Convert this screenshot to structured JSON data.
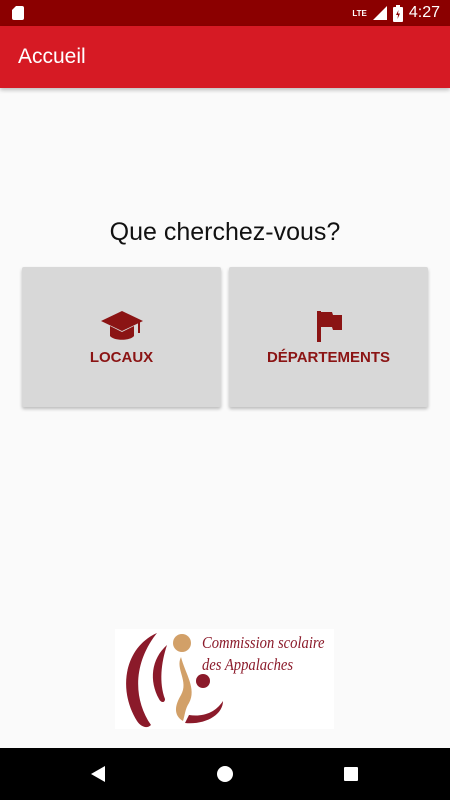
{
  "status_bar": {
    "network": "LTE",
    "time": "4:27"
  },
  "app_bar": {
    "title": "Accueil"
  },
  "main": {
    "question": "Que cherchez-vous?",
    "buttons": [
      {
        "label": "LOCAUX",
        "icon": "graduation-cap-icon"
      },
      {
        "label": "DÉPARTEMENTS",
        "icon": "flag-icon"
      }
    ]
  },
  "logo": {
    "line1": "Commission scolaire",
    "line2": "des Appalaches"
  },
  "nav_bar": {
    "icons": [
      "back-icon",
      "home-icon",
      "recents-icon"
    ]
  },
  "colors": {
    "status_bar": "#8b0000",
    "app_bar": "#d61a24",
    "accent": "#8b1414",
    "button_bg": "#d8d8d8"
  }
}
